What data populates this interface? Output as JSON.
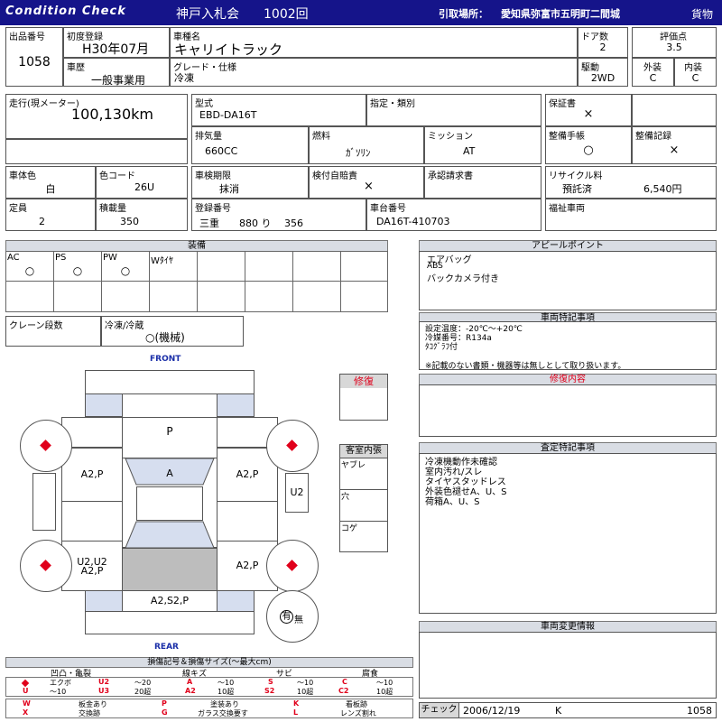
{
  "header": {
    "brand": "Condition Check",
    "auction": "神戸入札会",
    "lot": "1002回",
    "pickup_label": "引取場所：",
    "pickup_place": "愛知県弥富市五明町二間城",
    "category": "貨物"
  },
  "info": {
    "lot_no_label": "出品番号",
    "lot_no": "1058",
    "first_reg_label": "初度登録",
    "first_reg": "H30年07月",
    "car_name_label": "車種名",
    "car_name": "キャリイトラック",
    "doors_label": "ドア数",
    "doors": "2",
    "score_label": "評価点",
    "score": "3.5",
    "history_label": "車歴",
    "history": "一般事業用",
    "grade_label": "グレード・仕様",
    "grade": "冷凍",
    "drive_label": "駆動",
    "drive": "2WD",
    "exterior_label": "外装",
    "exterior": "C",
    "interior_label": "内装",
    "interior": "C"
  },
  "spec": {
    "mileage_label": "走行(現メーター)",
    "mileage": "100,130km",
    "model_label": "型式",
    "model": "EBD-DA16T",
    "designation_label": "指定・類別",
    "warranty_label": "保証書",
    "warranty": "×",
    "displacement_label": "排気量",
    "displacement": "660CC",
    "fuel_label": "燃料",
    "fuel": "ｶﾞｿﾘﾝ",
    "mission_label": "ミッション",
    "mission": "AT",
    "maint_book_label": "整備手帳",
    "maint_book": "○",
    "maint_record_label": "整備記録",
    "maint_record": "×",
    "body_color_label": "車体色",
    "body_color": "白",
    "color_code_label": "色コード",
    "color_code": "26U",
    "inspection_label": "車検期限",
    "inspection": "抹消",
    "insurance_label": "検付自賠責",
    "insurance": "×",
    "approval_label": "承認請求書",
    "recycle_label": "リサイクル料",
    "recycle_status": "預託済",
    "recycle_fee": "6,540円",
    "capacity_label": "定員",
    "capacity": "2",
    "load_label": "積載量",
    "load": "350",
    "reg_no_label": "登録番号",
    "reg_no": "三重　　880 り　 356",
    "chassis_label": "車台番号",
    "chassis": "DA16T-410703",
    "welfare_label": "福祉車両"
  },
  "equipment": {
    "title": "装備",
    "items": [
      {
        "label": "AC",
        "value": "○"
      },
      {
        "label": "PS",
        "value": "○"
      },
      {
        "label": "PW",
        "value": "○"
      },
      {
        "label": "Wﾀｲﾔ",
        "value": ""
      }
    ],
    "crane_label": "クレーン段数",
    "freezer_label": "冷凍/冷蔵",
    "freezer": "○(機械)"
  },
  "appeal": {
    "title": "アピールポイント",
    "lines": [
      "エアバッグ",
      "ABS",
      "バックカメラ付き"
    ]
  },
  "special": {
    "title": "車両特記事項",
    "lines": [
      "設定温度：-20℃～+20℃",
      "冷媒番号：R134a",
      "ﾀｺｸﾞﾗﾌ付"
    ],
    "note": "※記載のない書類・機器等は無しとして取り扱います。"
  },
  "repair": {
    "label": "修復",
    "content_title": "修復内容"
  },
  "diagram": {
    "front": "FRONT",
    "rear": "REAR",
    "marks": {
      "hood": "P",
      "left_front": "A2,P",
      "windshield": "A",
      "right_front": "A2,P",
      "right_side": "U2",
      "left_rear": "U2,U2\nA2,P",
      "right_rear": "A2,P",
      "rear": "A2,S2,P"
    },
    "spare_yes": "有",
    "spare_no": "無"
  },
  "interior_box": {
    "title": "客室内張",
    "rows": [
      "ヤブレ",
      "穴",
      "コゲ"
    ]
  },
  "assess": {
    "title": "査定特記事項",
    "lines": [
      "冷凍機動作未確認",
      "室内汚れ/スレ",
      "タイヤスタッドレス",
      "外装色褪せA、U、S",
      "荷箱A、U、S"
    ]
  },
  "change": {
    "title": "車両変更情報"
  },
  "legend": {
    "title": "損傷記号＆損傷サイズ(～最大cm)",
    "groups": [
      "凹凸・亀裂",
      "線キズ",
      "サビ",
      "腐食"
    ],
    "dent": [
      "エクボ",
      "U2",
      "～20",
      "U",
      "～10",
      "U3",
      "20超"
    ],
    "scratch": [
      "A",
      "～10",
      "A2",
      "10超"
    ],
    "rust": [
      "S",
      "～10",
      "S2",
      "10超"
    ],
    "corrosion": [
      "C",
      "～10",
      "C2",
      "10超"
    ],
    "row3": [
      "W",
      "板金あり",
      "P",
      "塗装あり",
      "K",
      "看板跡"
    ],
    "row4": [
      "X",
      "交換跡",
      "G",
      "ガラス交換要す",
      "L",
      "レンズ割れ"
    ]
  },
  "footer": {
    "check_label": "チェック",
    "check_date": "2006/12/19",
    "checker": "K",
    "lot_no": "1058"
  }
}
